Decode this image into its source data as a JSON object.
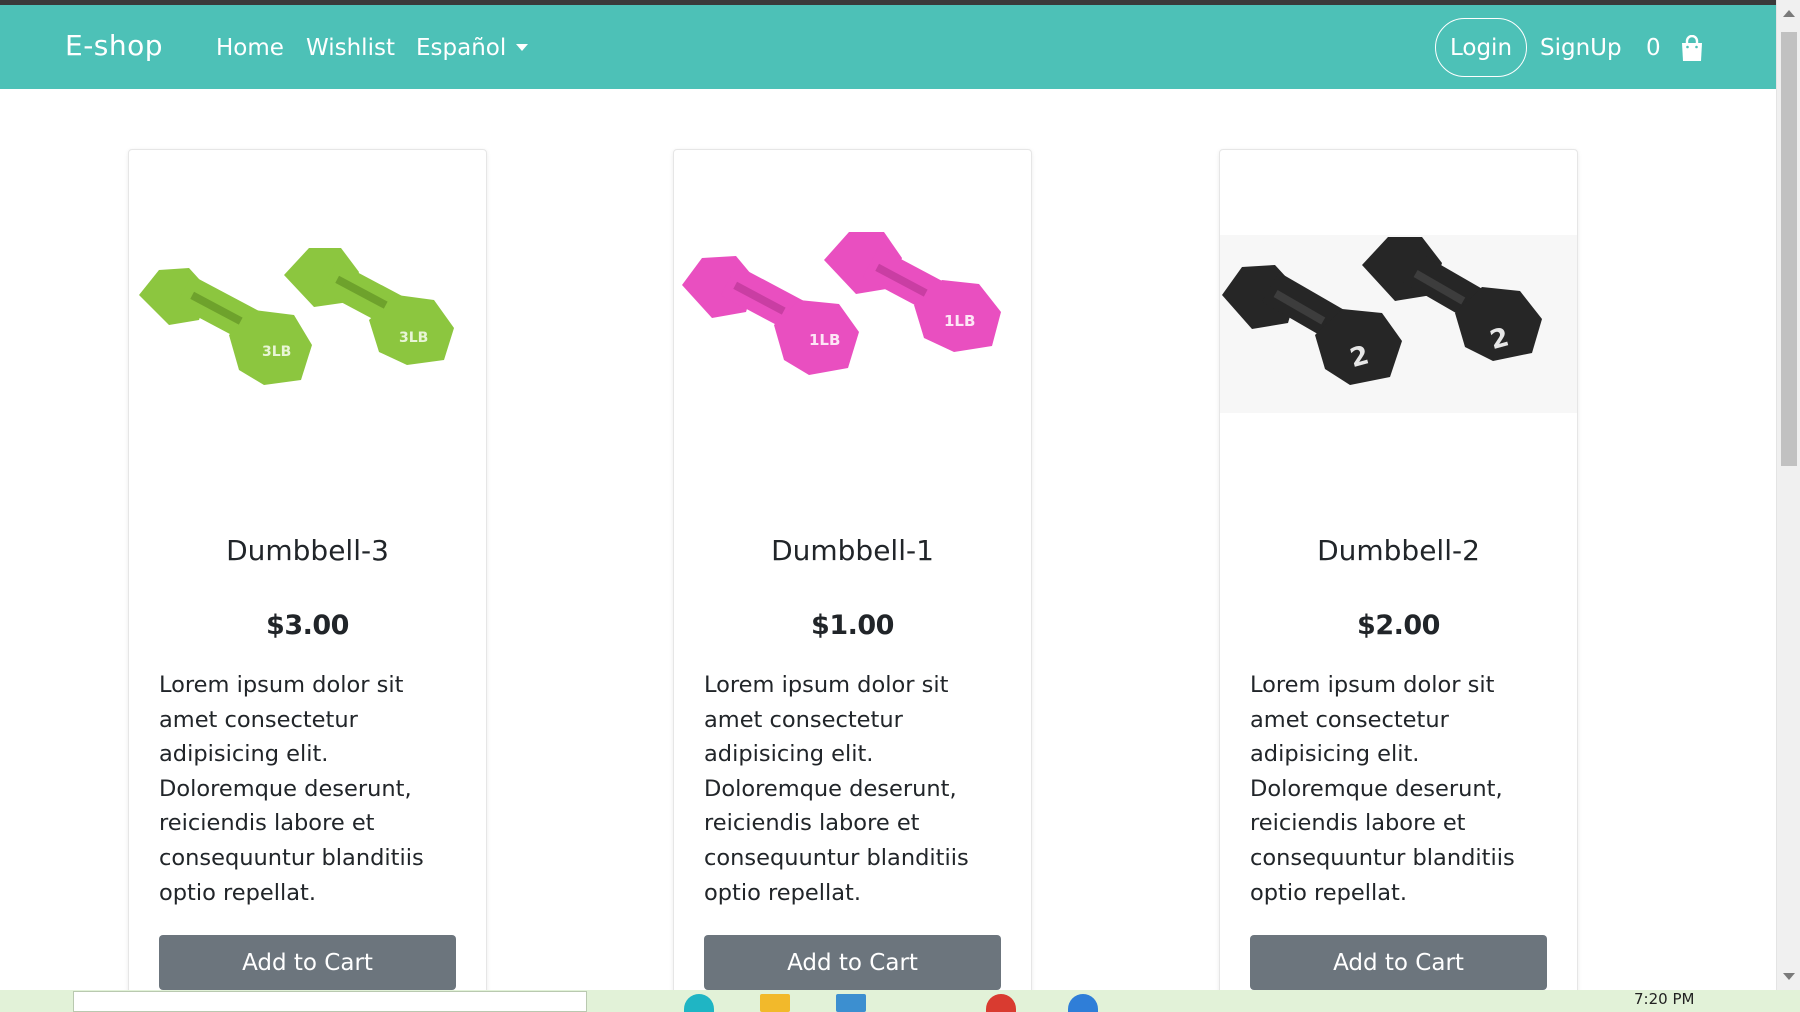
{
  "colors": {
    "navbar": "#4dc1b7",
    "button": "#6c757d",
    "taskbar": "#e2f2d8"
  },
  "navbar": {
    "brand": "E-shop",
    "links": [
      "Home",
      "Wishlist"
    ],
    "language": "Español",
    "login": "Login",
    "signup": "SignUp",
    "cart_count": "0",
    "cart_icon": "shopping-bag-icon"
  },
  "products": [
    {
      "name": "Dumbbell-3",
      "price": "$3.00",
      "description": "Lorem ipsum dolor sit amet consectetur adipisicing elit. Doloremque deserunt, reiciendis labore et consequuntur blanditiis optio repellat.",
      "button": "Add to Cart",
      "image_color": "#8cc63f",
      "image_label": "3LB"
    },
    {
      "name": "Dumbbell-1",
      "price": "$1.00",
      "description": "Lorem ipsum dolor sit amet consectetur adipisicing elit. Doloremque deserunt, reiciendis labore et consequuntur blanditiis optio repellat.",
      "button": "Add to Cart",
      "image_color": "#e94fc0",
      "image_label": "1LB"
    },
    {
      "name": "Dumbbell-2",
      "price": "$2.00",
      "description": "Lorem ipsum dolor sit amet consectetur adipisicing elit. Doloremque deserunt, reiciendis labore et consequuntur blanditiis optio repellat.",
      "button": "Add to Cart",
      "image_color": "#262626",
      "image_label": "2"
    }
  ],
  "taskbar": {
    "time": "7:20 PM"
  }
}
